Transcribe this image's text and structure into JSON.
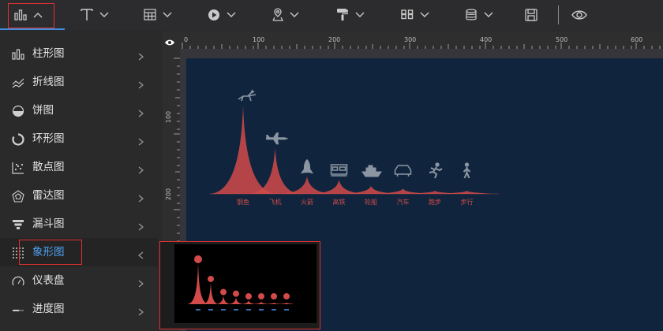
{
  "toolbar": {
    "items": [
      {
        "icon": "bar-chart-icon",
        "chevron": "chevron-up-icon",
        "active": true
      },
      {
        "icon": "text-icon",
        "chevron": "chevron-down-icon"
      },
      {
        "icon": "table-icon",
        "chevron": "chevron-down-icon"
      },
      {
        "icon": "media-play-icon",
        "chevron": "chevron-down-icon"
      },
      {
        "icon": "map-pin-icon",
        "chevron": "chevron-down-icon"
      },
      {
        "icon": "paint-roller-icon",
        "chevron": "chevron-down-icon"
      },
      {
        "icon": "digital-number-icon",
        "chevron": "chevron-down-icon"
      },
      {
        "icon": "database-icon",
        "chevron": "chevron-down-icon"
      },
      {
        "icon": "save-icon"
      },
      {
        "icon": "eye-icon"
      }
    ],
    "accent_color": "#3d8bd9",
    "highlight_color": "#e03131"
  },
  "sidebar": {
    "items": [
      {
        "label": "柱形图",
        "icon": "bar-chart-icon"
      },
      {
        "label": "折线图",
        "icon": "line-chart-icon"
      },
      {
        "label": "饼图",
        "icon": "pie-chart-icon"
      },
      {
        "label": "环形图",
        "icon": "ring-chart-icon"
      },
      {
        "label": "散点图",
        "icon": "scatter-chart-icon"
      },
      {
        "label": "雷达图",
        "icon": "radar-chart-icon"
      },
      {
        "label": "漏斗图",
        "icon": "funnel-chart-icon"
      },
      {
        "label": "象形图",
        "icon": "pictorial-chart-icon",
        "active": true
      },
      {
        "label": "仪表盘",
        "icon": "gauge-icon"
      },
      {
        "label": "进度图",
        "icon": "progress-icon"
      }
    ],
    "active_color": "#4fa3f2"
  },
  "ruler": {
    "top_ticks": [
      "0",
      "100",
      "200",
      "300",
      "400",
      "500",
      "600"
    ],
    "left_ticks": [
      "100",
      "200"
    ]
  },
  "chart_data": {
    "type": "bar",
    "categories": [
      "钢鱼",
      "飞机",
      "火箭",
      "高铁",
      "轮船",
      "汽车",
      "跑步",
      "步行"
    ],
    "values": [
      100,
      52,
      20,
      16,
      9,
      6,
      2,
      1
    ],
    "ylim": [
      0,
      100
    ],
    "bar_shape": "spike",
    "symbols": [
      "deer-icon",
      "plane-icon",
      "rocket-icon",
      "train-icon",
      "ship-icon",
      "car-icon",
      "runner-icon",
      "walker-icon"
    ],
    "color": "#d24a4a",
    "symbol_color": "#8c96a3"
  },
  "preview": {
    "colors": {
      "bar": "#d24a4a",
      "background": "#000000"
    }
  }
}
